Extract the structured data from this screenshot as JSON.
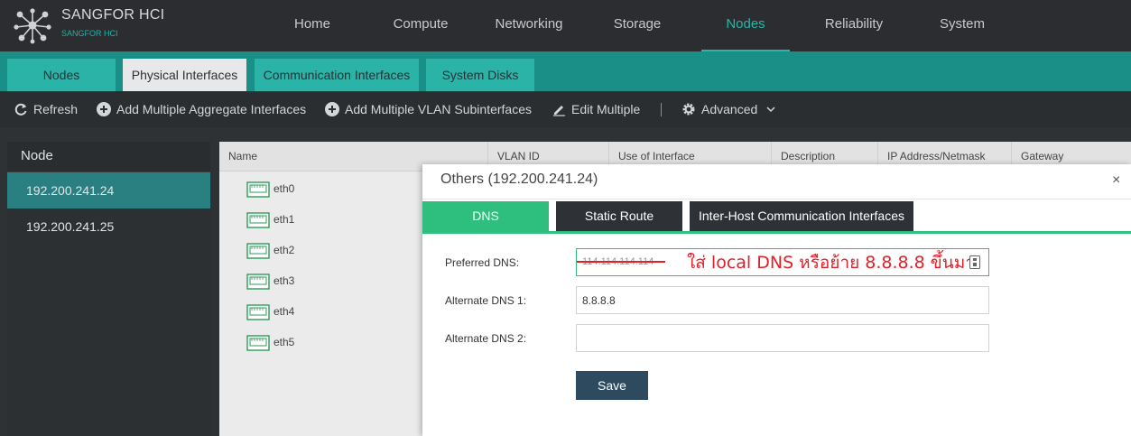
{
  "app": {
    "brand": "SANGFOR HCI",
    "brand_sub": "SANGFOR HCI"
  },
  "nav": {
    "items": [
      {
        "label": "Home"
      },
      {
        "label": "Compute"
      },
      {
        "label": "Networking"
      },
      {
        "label": "Storage"
      },
      {
        "label": "Nodes"
      },
      {
        "label": "Reliability"
      },
      {
        "label": "System"
      }
    ],
    "active": "Nodes"
  },
  "subtabs": [
    {
      "label": "Nodes"
    },
    {
      "label": "Physical Interfaces"
    },
    {
      "label": "Communication Interfaces"
    },
    {
      "label": "System Disks"
    }
  ],
  "toolbar": {
    "refresh": "Refresh",
    "add_aggregate": "Add Multiple Aggregate Interfaces",
    "add_vlan": "Add Multiple VLAN Subinterfaces",
    "edit_multiple": "Edit Multiple",
    "advanced": "Advanced"
  },
  "node_panel": {
    "header": "Node",
    "nodes": [
      {
        "label": "192.200.241.24"
      },
      {
        "label": "192.200.241.25"
      }
    ]
  },
  "table": {
    "columns": [
      "Name",
      "VLAN ID",
      "Use of Interface",
      "Description",
      "IP Address/Netmask",
      "Gateway"
    ],
    "rows": [
      {
        "name": "eth0"
      },
      {
        "name": "eth1"
      },
      {
        "name": "eth2"
      },
      {
        "name": "eth3"
      },
      {
        "name": "eth4"
      },
      {
        "name": "eth5"
      }
    ]
  },
  "modal": {
    "title": "Others (192.200.241.24)",
    "close": "×",
    "tabs": [
      {
        "label": "DNS"
      },
      {
        "label": "Static Route"
      },
      {
        "label": "Inter-Host Communication Interfaces"
      }
    ],
    "fields": {
      "preferred": {
        "label": "Preferred DNS:",
        "value": "114.114.114.114"
      },
      "alternate1": {
        "label": "Alternate DNS 1:",
        "value": "8.8.8.8"
      },
      "alternate2": {
        "label": "Alternate DNS 2:",
        "value": ""
      }
    },
    "annotation": "ใส่ local DNS หรือย้าย 8.8.8.8 ขึ้นมา",
    "save": "Save"
  },
  "colors": {
    "accent": "#27b6a8",
    "tab_active": "#2ebf7e",
    "annotation": "#e3202a",
    "save_button": "#2d4a5e"
  }
}
